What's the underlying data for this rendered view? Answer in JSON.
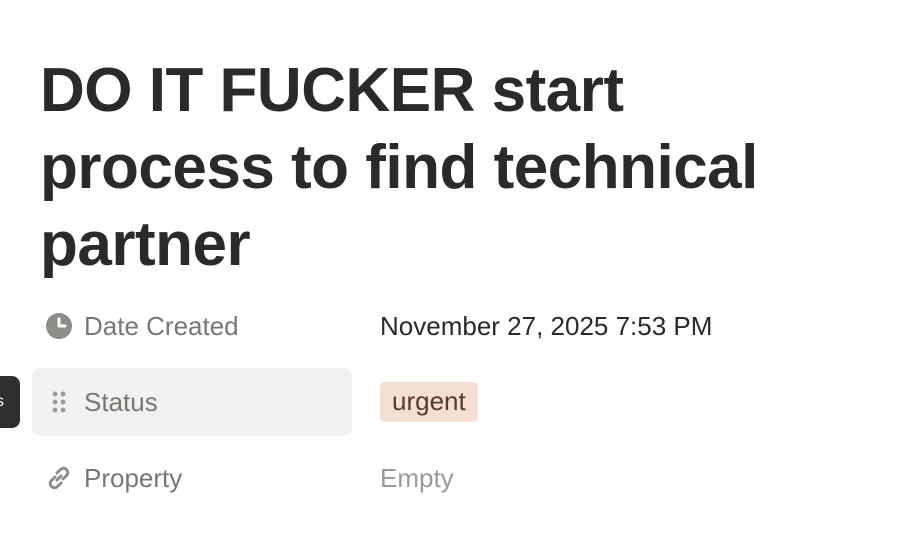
{
  "page": {
    "title": "DO IT FUCKER start process to find technical partner",
    "side_tab_glyph": "s"
  },
  "properties": [
    {
      "icon": "clock-icon",
      "label": "Date Created",
      "value": "November 27, 2025 7:53 PM"
    },
    {
      "icon": "drag-handle-icon",
      "label": "Status",
      "value": "urgent",
      "tag_color": "#f4dfd3",
      "tag_text_color": "#5a3a2a"
    },
    {
      "icon": "link-icon",
      "label": "Property",
      "value": "Empty"
    }
  ],
  "colors": {
    "label_text": "#787774",
    "value_text": "#2b2a28",
    "hover_background": "#f1f1ef",
    "empty_text": "#9b9a97"
  }
}
